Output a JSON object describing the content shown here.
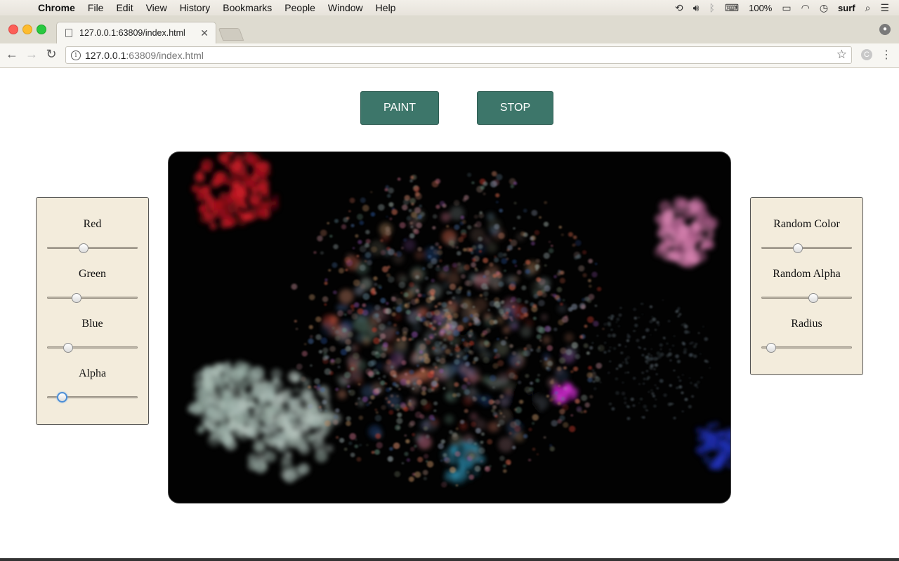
{
  "menubar": {
    "app": "Chrome",
    "items": [
      "File",
      "Edit",
      "View",
      "History",
      "Bookmarks",
      "People",
      "Window",
      "Help"
    ],
    "battery": "100%",
    "user": "surf"
  },
  "tab": {
    "title": "127.0.0.1:63809/index.html"
  },
  "address": {
    "host": "127.0.0.1",
    "rest": ":63809/index.html"
  },
  "buttons": {
    "paint": "PAINT",
    "stop": "STOP"
  },
  "controls_left": [
    {
      "label": "Red",
      "value": 0.39
    },
    {
      "label": "Green",
      "value": 0.3
    },
    {
      "label": "Blue",
      "value": 0.2
    },
    {
      "label": "Alpha",
      "value": 0.12
    }
  ],
  "controls_right": [
    {
      "label": "Random Color",
      "value": 0.39
    },
    {
      "label": "Random Alpha",
      "value": 0.58
    },
    {
      "label": "Radius",
      "value": 0.06
    }
  ]
}
